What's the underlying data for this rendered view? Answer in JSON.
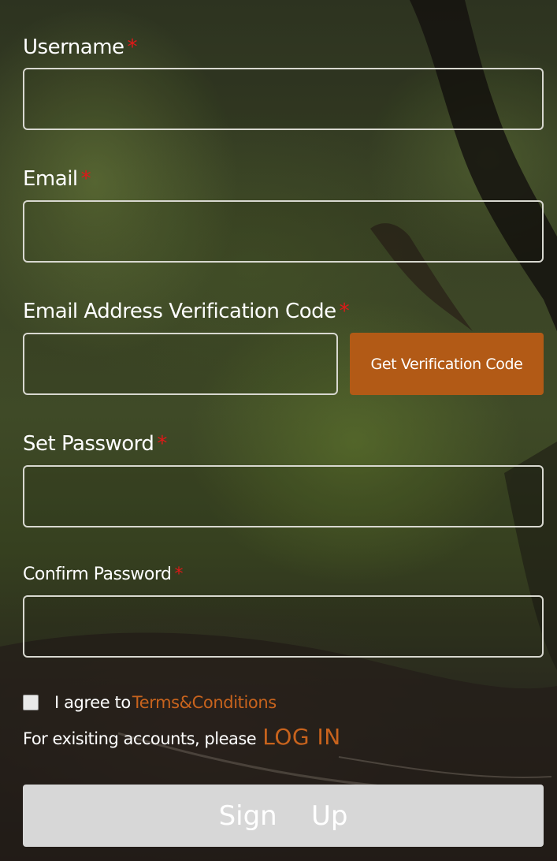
{
  "form": {
    "username": {
      "label": "Username",
      "required_mark": "*",
      "value": "",
      "placeholder": ""
    },
    "email": {
      "label": "Email",
      "required_mark": "*",
      "value": "",
      "placeholder": ""
    },
    "verification": {
      "label": "Email Address Verification Code",
      "required_mark": "*",
      "value": "",
      "placeholder": "",
      "button_label": "Get Verification Code"
    },
    "password": {
      "label": "Set Password",
      "required_mark": "*",
      "value": "",
      "placeholder": ""
    },
    "confirm_password": {
      "label": "Confirm Password",
      "required_mark": "*",
      "value": "",
      "placeholder": ""
    },
    "agree": {
      "checked": false,
      "text": "I agree to",
      "link_text": "Terms&Conditions"
    },
    "login_prompt": {
      "text": "For exisiting accounts, please",
      "link_text": "LOG IN"
    },
    "submit_label": "Sign    Up"
  },
  "colors": {
    "accent": "#b25a16",
    "link": "#c8631d",
    "required": "#e01818",
    "submit_background": "#d7d7d7",
    "field_border": "#d8d8d0"
  }
}
